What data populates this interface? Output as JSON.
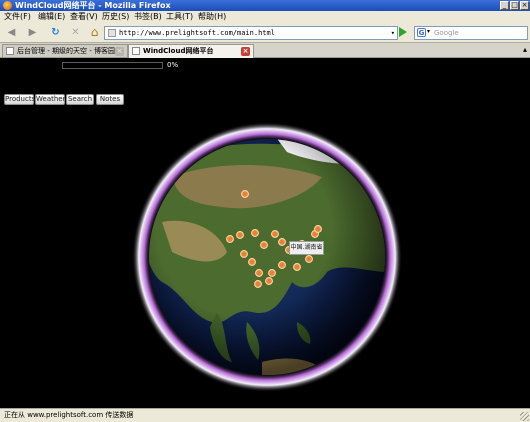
{
  "window": {
    "title": "WindCloud网络平台 - Mozilla Firefox",
    "min_glyph": "_",
    "max_glyph": "□",
    "close_glyph": "×"
  },
  "menu": [
    "文件(F)",
    "编辑(E)",
    "查看(V)",
    "历史(S)",
    "书签(B)",
    "工具(T)",
    "帮助(H)"
  ],
  "nav": {
    "url": "http://www.prelightsoft.com/main.html",
    "search_placeholder": "Google",
    "back_icon": "back-arrow-icon",
    "forward_icon": "forward-arrow-icon",
    "reload_icon": "reload-icon",
    "stop_icon": "stop-icon",
    "home_icon": "home-icon",
    "back_glyph": "◀",
    "forward_glyph": "▶",
    "reload_glyph": "↻",
    "stop_glyph": "✕",
    "home_glyph": "⌂",
    "dropdown_glyph": "▾",
    "search_engine_glyph": "G"
  },
  "tabs": [
    {
      "label": "后台管理 - 期级的天空 - 博客园",
      "active": false
    },
    {
      "label": "WindCloud网络平台",
      "active": true
    }
  ],
  "tab_close_glyph": "×",
  "tab_overflow_glyph": "▴",
  "progress": {
    "value": 0,
    "label": "0%"
  },
  "buttons": {
    "products": "Products",
    "weather": "Weather",
    "search": "Search",
    "notes": "Notes"
  },
  "map": {
    "tooltip": "中国.湖南省",
    "marker_color": "#e8823a",
    "markers": 20
  },
  "status": {
    "text": "正在从 www.prelightsoft.com 传送数据"
  }
}
